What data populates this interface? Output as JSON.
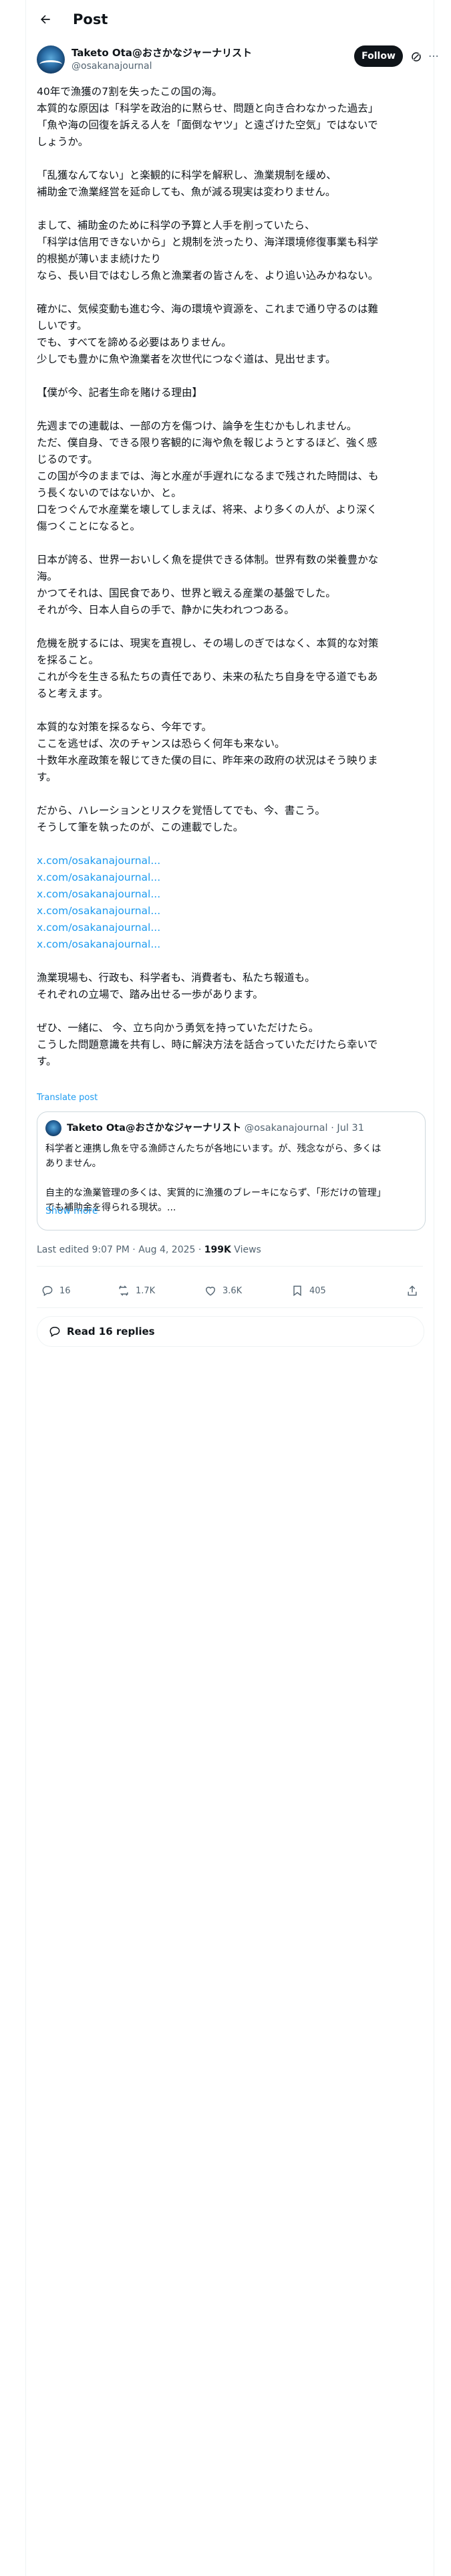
{
  "header": {
    "title": "Post"
  },
  "author": {
    "name": "Taketo Ota@おさかなジャーナリスト",
    "handle": "@osakanajournal",
    "follow_label": "Follow"
  },
  "post": {
    "paragraphs": [
      [
        "40年で漁獲の7割を失ったこの国の海。",
        "本質的な原因は「科学を政治的に黙らせ、問題と向き合わなかった過去」",
        "「魚や海の回復を訴える人を「面倒なヤツ」と遠ざけた空気」ではないで",
        "しょうか。"
      ],
      [
        "「乱獲なんてない」と楽観的に科学を解釈し、漁業規制を緩め、",
        "補助金で漁業経営を延命しても、魚が減る現実は変わりません。"
      ],
      [
        "まして、補助金のために科学の予算と人手を削っていたら、",
        "「科学は信用できないから」と規制を渋ったり、海洋環境修復事業も科学",
        "的根拠が薄いまま続けたり",
        "なら、長い目ではむしろ魚と漁業者の皆さんを、より追い込みかねない。"
      ],
      [
        "確かに、気候変動も進む今、海の環境や資源を、これまで通り守るのは難",
        "しいです。",
        "でも、すべてを諦める必要はありません。",
        "少しでも豊かに魚や漁業者を次世代につなぐ道は、見出せます。"
      ],
      [
        "【僕が今、記者生命を賭ける理由】"
      ],
      [
        "先週までの連載は、一部の方を傷つけ、論争を生むかもしれません。",
        "ただ、僕自身、できる限り客観的に海や魚を報じようとするほど、強く感",
        "じるのです。",
        "この国が今のままでは、海と水産が手遅れになるまで残された時間は、も",
        "う長くないのではないか、と。",
        "口をつぐんで水産業を壊してしまえば、将来、より多くの人が、より深く",
        "傷つくことになると。"
      ],
      [
        "日本が誇る、世界一おいしく魚を提供できる体制。世界有数の栄養豊かな",
        "海。",
        "かつてそれは、国民食であり、世界と戦える産業の基盤でした。",
        "それが今、日本人自らの手で、静かに失われつつある。"
      ],
      [
        "危機を脱するには、現実を直視し、その場しのぎではなく、本質的な対策",
        "を採ること。",
        "これが今を生きる私たちの責任であり、未来の私たち自身を守る道でもあ",
        "ると考えます。"
      ],
      [
        "本質的な対策を採るなら、今年です。",
        "ここを逃せば、次のチャンスは恐らく何年も来ない。",
        "十数年水産政策を報じてきた僕の目に、昨年来の政府の状況はそう映りま",
        "す。"
      ],
      [
        "だから、ハレーションとリスクを覚悟してでも、今、書こう。",
        "そうして筆を執ったのが、この連載でした。"
      ]
    ],
    "links": [
      "x.com/osakanajournal...",
      "x.com/osakanajournal...",
      "x.com/osakanajournal...",
      "x.com/osakanajournal...",
      "x.com/osakanajournal...",
      "x.com/osakanajournal..."
    ],
    "closing": [
      [
        "漁業現場も、行政も、科学者も、消費者も、私たち報道も。",
        "それぞれの立場で、踏み出せる一歩があります。"
      ],
      [
        "ぜひ、一緒に、 今、立ち向かう勇気を持っていただけたら。",
        "こうした問題意識を共有し、時に解決方法を話合っていただけたら幸いで",
        "す。"
      ]
    ],
    "translate_label": "Translate post"
  },
  "quote": {
    "name": "Taketo Ota@おさかなジャーナリスト",
    "handle": "@osakanajournal",
    "date": "· Jul 31",
    "lines": [
      "科学者と連携し魚を守る漁師さんたちが各地にいます。が、残念ながら、多くは",
      "ありません。",
      "",
      "自主的な漁業管理の多くは、実質的に漁獲のブレーキにならず、「形だけの管理」",
      "でも補助金を得られる現状。..."
    ],
    "show_more": "Show more"
  },
  "meta": {
    "edited": "Last edited 9:07 PM · Aug 4, 2025 · ",
    "views": "199K",
    "views_label": " Views"
  },
  "actions": {
    "replies": "16",
    "reposts": "1.7K",
    "likes": "3.6K",
    "bookmarks": "405"
  },
  "read_replies": "Read 16 replies"
}
